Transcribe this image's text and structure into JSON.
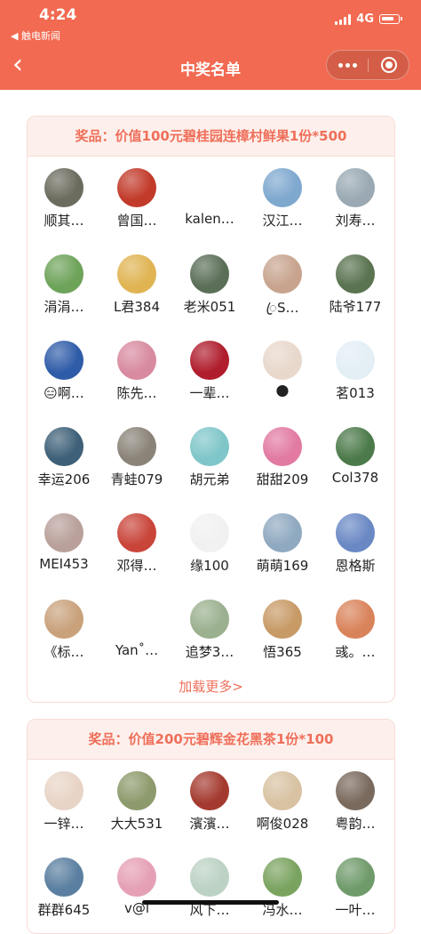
{
  "status_bar": {
    "time": "4:24",
    "back_app": "◀ 触电新闻",
    "network": "4G"
  },
  "nav": {
    "title": "中奖名单"
  },
  "colors": {
    "brand": "#f26a51",
    "accent_text": "#ef6f5a",
    "card_head_bg": "#fdf0ec"
  },
  "prizes": [
    {
      "title": "奖品：价值100元碧桂园连樟村鲜果1份*500",
      "load_more": "加载更多>",
      "winners": [
        {
          "name": "顺其…",
          "avatar": "#6b6b5e"
        },
        {
          "name": "曾国…",
          "avatar": "#c23a2a"
        },
        {
          "name": "kalen…",
          "avatar": "#ffffff"
        },
        {
          "name": "汉江…",
          "avatar": "#7fa8cf"
        },
        {
          "name": "刘寿…",
          "avatar": "#9aa9b3"
        },
        {
          "name": "涓涓…",
          "avatar": "#6ea35a"
        },
        {
          "name": "L君384",
          "avatar": "#e0b453"
        },
        {
          "name": "老米051",
          "avatar": "#5b6e58"
        },
        {
          "name": "ꦿS…",
          "avatar": "#c8a48f"
        },
        {
          "name": "陆爷177",
          "avatar": "#5a7350"
        },
        {
          "name": "😑啊…",
          "avatar": "#2f5ca8"
        },
        {
          "name": "陈先…",
          "avatar": "#d88aa0"
        },
        {
          "name": "一辈…",
          "avatar": "#b01d2d"
        },
        {
          "name": "🌑",
          "avatar": "#e8d8cc"
        },
        {
          "name": "茗013",
          "avatar": "#e3eef5"
        },
        {
          "name": "幸运206",
          "avatar": "#3e6078"
        },
        {
          "name": "青蛙079",
          "avatar": "#8a8378"
        },
        {
          "name": "胡元弟",
          "avatar": "#7fc6c9"
        },
        {
          "name": "甜甜209",
          "avatar": "#e27aa2"
        },
        {
          "name": "Col378",
          "avatar": "#4c7a4a"
        },
        {
          "name": "MEI453",
          "avatar": "#b9a09b"
        },
        {
          "name": "邓得…",
          "avatar": "#c9453a"
        },
        {
          "name": "缘100",
          "avatar": "#f1f1f1"
        },
        {
          "name": "萌萌169",
          "avatar": "#8fa9c0"
        },
        {
          "name": "恩格斯",
          "avatar": "#6a88c4"
        },
        {
          "name": "《标…",
          "avatar": "#c9a27c"
        },
        {
          "name": "Yan˚…",
          "avatar": "#ffffff"
        },
        {
          "name": "追梦3…",
          "avatar": "#9bb08e"
        },
        {
          "name": "悟365",
          "avatar": "#c79a66"
        },
        {
          "name": "彧。…",
          "avatar": "#d9835a"
        }
      ]
    },
    {
      "title": "奖品：价值200元碧辉金花黑茶1份*100",
      "winners": [
        {
          "name": "一锌…",
          "avatar": "#e8d4c6"
        },
        {
          "name": "大大531",
          "avatar": "#8d9a6c"
        },
        {
          "name": "濱濱…",
          "avatar": "#a43a2f"
        },
        {
          "name": "啊俊028",
          "avatar": "#d8c2a2"
        },
        {
          "name": "粤韵…",
          "avatar": "#7a6a5e"
        },
        {
          "name": "群群645",
          "avatar": "#5a7fa0"
        },
        {
          "name": "v@l",
          "avatar": "#e5a0b5"
        },
        {
          "name": "风下…",
          "avatar": "#bcd2c4"
        },
        {
          "name": "冯水…",
          "avatar": "#7aa360"
        },
        {
          "name": "一叶…",
          "avatar": "#6f9a6a"
        }
      ]
    }
  ]
}
